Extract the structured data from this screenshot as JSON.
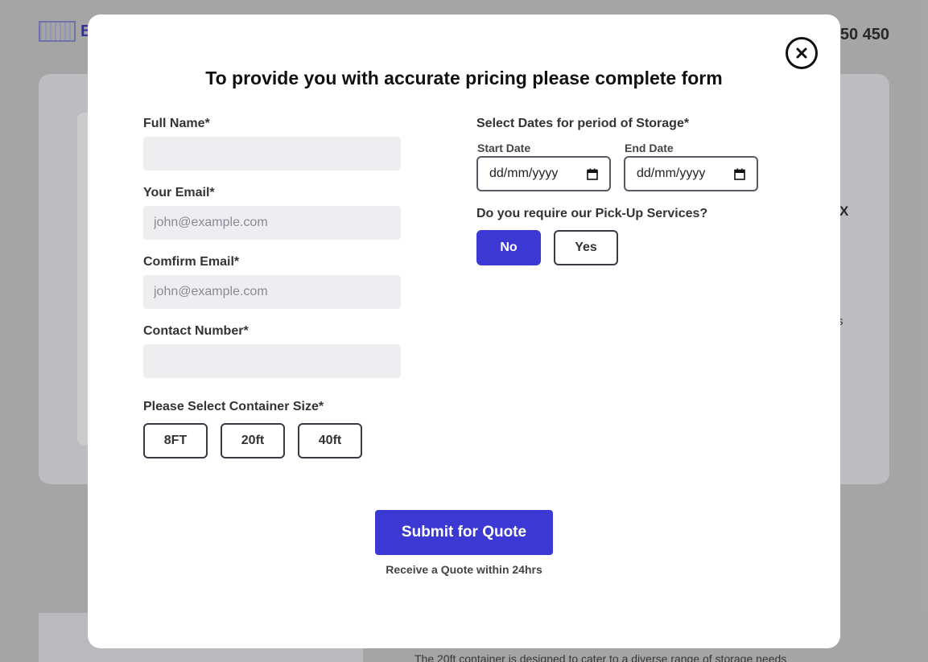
{
  "background": {
    "logo_letter": "B",
    "phone_partial": "50 450",
    "panel_partial_x": "X",
    "panel_partial_s": "s",
    "bottom_paragraph": "The 20ft container is designed to cater to a diverse range of storage needs"
  },
  "modal": {
    "title": "To provide you with accurate pricing please complete form",
    "close_icon": "close-icon",
    "full_name": {
      "label": "Full Name*",
      "value": "",
      "placeholder": ""
    },
    "email": {
      "label": "Your Email*",
      "value": "",
      "placeholder": "john@example.com"
    },
    "confirm_email": {
      "label": "Comfirm Email*",
      "value": "",
      "placeholder": "john@example.com"
    },
    "contact_number": {
      "label": "Contact Number*",
      "value": "",
      "placeholder": ""
    },
    "container_size": {
      "label": "Please Select Container Size*",
      "options": [
        "8FT",
        "20ft",
        "40ft"
      ]
    },
    "dates": {
      "label": "Select Dates for period of Storage*",
      "start_label": "Start Date",
      "start_value": "dd/mm/yyyy",
      "end_label": "End Date",
      "end_value": "dd/mm/yyyy",
      "calendar_icon": "calendar-icon"
    },
    "pickup": {
      "label": "Do you require our Pick-Up Services?",
      "options": [
        "No",
        "Yes"
      ],
      "selected": "No"
    },
    "submit_label": "Submit for Quote",
    "submit_note": "Receive a Quote within 24hrs"
  },
  "colors": {
    "accent": "#3b38d4",
    "input_bg": "#eeeef0",
    "overlay": "rgba(0,0,0,0.20)"
  }
}
